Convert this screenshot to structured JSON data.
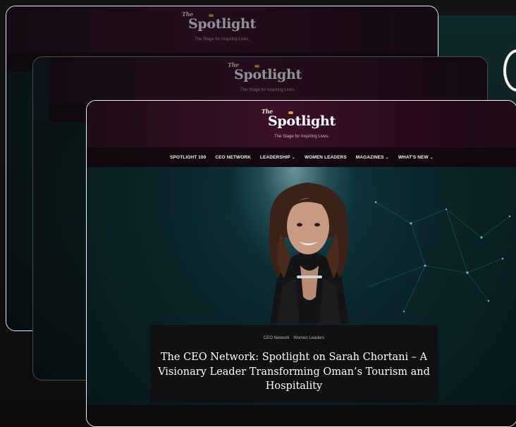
{
  "site": {
    "logo_prefix": "The",
    "logo_a": "Sp",
    "logo_o": "o",
    "logo_b": "tlight",
    "tagline": "The Stage for Inspiring Lives."
  },
  "nav": {
    "items": [
      {
        "label": "SPOTLIGHT 100",
        "dropdown": false
      },
      {
        "label": "CEO NETWORK",
        "dropdown": false
      },
      {
        "label": "LEADERSHIP",
        "dropdown": true
      },
      {
        "label": "WOMEN LEADERS",
        "dropdown": false
      },
      {
        "label": "MAGAZINES",
        "dropdown": true
      },
      {
        "label": "WHAT'S NEW",
        "dropdown": true
      }
    ],
    "chevron_glyph": "⌄"
  },
  "article": {
    "categories": [
      "CEO Network",
      "Women Leaders"
    ],
    "title": "The CEO Network: Spotlight on Sarah Chortani – A Visionary Leader Transforming Oman’s Tourism and Hospitality"
  },
  "colors": {
    "header_plum": "#3a1029",
    "nav_bg": "#14080f",
    "hero_teal": "#0a2529",
    "logo_accent_gold": "#d6a435"
  },
  "icons": {
    "dropdown": "chevron-down-icon",
    "logo_mark": "spotlight-o-mark-icon"
  }
}
